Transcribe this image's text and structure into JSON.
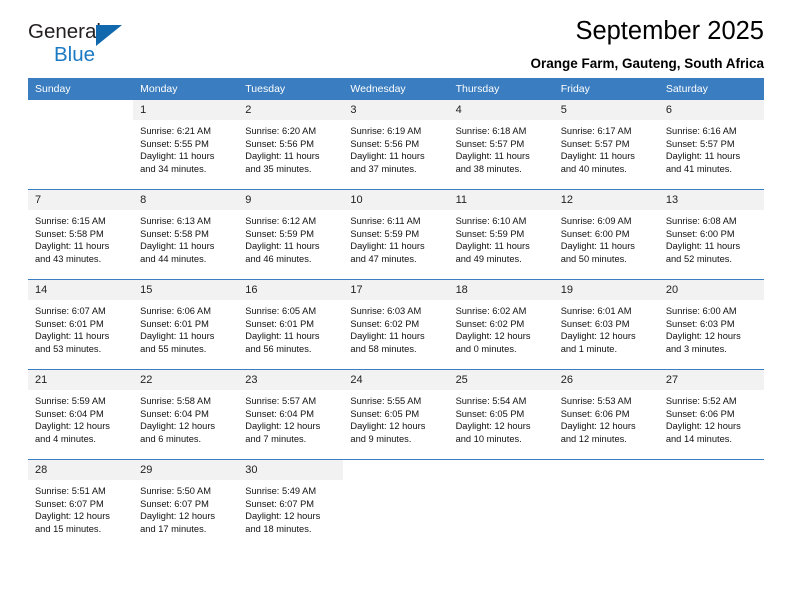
{
  "brand": {
    "name_part1": "General",
    "name_part2": "Blue",
    "logo_icon": "triangle-flag-icon",
    "accent_color": "#1268ad"
  },
  "header": {
    "title": "September 2025",
    "subtitle": "Orange Farm, Gauteng, South Africa"
  },
  "theme": {
    "header_blue": "#3a7dc0",
    "daynum_gray": "#f2f2f2"
  },
  "weekday_headers": [
    "Sunday",
    "Monday",
    "Tuesday",
    "Wednesday",
    "Thursday",
    "Friday",
    "Saturday"
  ],
  "weeks": [
    [
      {
        "day": "",
        "sunrise": "",
        "sunset": "",
        "daylight1": "",
        "daylight2": ""
      },
      {
        "day": "1",
        "sunrise": "Sunrise: 6:21 AM",
        "sunset": "Sunset: 5:55 PM",
        "daylight1": "Daylight: 11 hours",
        "daylight2": "and 34 minutes."
      },
      {
        "day": "2",
        "sunrise": "Sunrise: 6:20 AM",
        "sunset": "Sunset: 5:56 PM",
        "daylight1": "Daylight: 11 hours",
        "daylight2": "and 35 minutes."
      },
      {
        "day": "3",
        "sunrise": "Sunrise: 6:19 AM",
        "sunset": "Sunset: 5:56 PM",
        "daylight1": "Daylight: 11 hours",
        "daylight2": "and 37 minutes."
      },
      {
        "day": "4",
        "sunrise": "Sunrise: 6:18 AM",
        "sunset": "Sunset: 5:57 PM",
        "daylight1": "Daylight: 11 hours",
        "daylight2": "and 38 minutes."
      },
      {
        "day": "5",
        "sunrise": "Sunrise: 6:17 AM",
        "sunset": "Sunset: 5:57 PM",
        "daylight1": "Daylight: 11 hours",
        "daylight2": "and 40 minutes."
      },
      {
        "day": "6",
        "sunrise": "Sunrise: 6:16 AM",
        "sunset": "Sunset: 5:57 PM",
        "daylight1": "Daylight: 11 hours",
        "daylight2": "and 41 minutes."
      }
    ],
    [
      {
        "day": "7",
        "sunrise": "Sunrise: 6:15 AM",
        "sunset": "Sunset: 5:58 PM",
        "daylight1": "Daylight: 11 hours",
        "daylight2": "and 43 minutes."
      },
      {
        "day": "8",
        "sunrise": "Sunrise: 6:13 AM",
        "sunset": "Sunset: 5:58 PM",
        "daylight1": "Daylight: 11 hours",
        "daylight2": "and 44 minutes."
      },
      {
        "day": "9",
        "sunrise": "Sunrise: 6:12 AM",
        "sunset": "Sunset: 5:59 PM",
        "daylight1": "Daylight: 11 hours",
        "daylight2": "and 46 minutes."
      },
      {
        "day": "10",
        "sunrise": "Sunrise: 6:11 AM",
        "sunset": "Sunset: 5:59 PM",
        "daylight1": "Daylight: 11 hours",
        "daylight2": "and 47 minutes."
      },
      {
        "day": "11",
        "sunrise": "Sunrise: 6:10 AM",
        "sunset": "Sunset: 5:59 PM",
        "daylight1": "Daylight: 11 hours",
        "daylight2": "and 49 minutes."
      },
      {
        "day": "12",
        "sunrise": "Sunrise: 6:09 AM",
        "sunset": "Sunset: 6:00 PM",
        "daylight1": "Daylight: 11 hours",
        "daylight2": "and 50 minutes."
      },
      {
        "day": "13",
        "sunrise": "Sunrise: 6:08 AM",
        "sunset": "Sunset: 6:00 PM",
        "daylight1": "Daylight: 11 hours",
        "daylight2": "and 52 minutes."
      }
    ],
    [
      {
        "day": "14",
        "sunrise": "Sunrise: 6:07 AM",
        "sunset": "Sunset: 6:01 PM",
        "daylight1": "Daylight: 11 hours",
        "daylight2": "and 53 minutes."
      },
      {
        "day": "15",
        "sunrise": "Sunrise: 6:06 AM",
        "sunset": "Sunset: 6:01 PM",
        "daylight1": "Daylight: 11 hours",
        "daylight2": "and 55 minutes."
      },
      {
        "day": "16",
        "sunrise": "Sunrise: 6:05 AM",
        "sunset": "Sunset: 6:01 PM",
        "daylight1": "Daylight: 11 hours",
        "daylight2": "and 56 minutes."
      },
      {
        "day": "17",
        "sunrise": "Sunrise: 6:03 AM",
        "sunset": "Sunset: 6:02 PM",
        "daylight1": "Daylight: 11 hours",
        "daylight2": "and 58 minutes."
      },
      {
        "day": "18",
        "sunrise": "Sunrise: 6:02 AM",
        "sunset": "Sunset: 6:02 PM",
        "daylight1": "Daylight: 12 hours",
        "daylight2": "and 0 minutes."
      },
      {
        "day": "19",
        "sunrise": "Sunrise: 6:01 AM",
        "sunset": "Sunset: 6:03 PM",
        "daylight1": "Daylight: 12 hours",
        "daylight2": "and 1 minute."
      },
      {
        "day": "20",
        "sunrise": "Sunrise: 6:00 AM",
        "sunset": "Sunset: 6:03 PM",
        "daylight1": "Daylight: 12 hours",
        "daylight2": "and 3 minutes."
      }
    ],
    [
      {
        "day": "21",
        "sunrise": "Sunrise: 5:59 AM",
        "sunset": "Sunset: 6:04 PM",
        "daylight1": "Daylight: 12 hours",
        "daylight2": "and 4 minutes."
      },
      {
        "day": "22",
        "sunrise": "Sunrise: 5:58 AM",
        "sunset": "Sunset: 6:04 PM",
        "daylight1": "Daylight: 12 hours",
        "daylight2": "and 6 minutes."
      },
      {
        "day": "23",
        "sunrise": "Sunrise: 5:57 AM",
        "sunset": "Sunset: 6:04 PM",
        "daylight1": "Daylight: 12 hours",
        "daylight2": "and 7 minutes."
      },
      {
        "day": "24",
        "sunrise": "Sunrise: 5:55 AM",
        "sunset": "Sunset: 6:05 PM",
        "daylight1": "Daylight: 12 hours",
        "daylight2": "and 9 minutes."
      },
      {
        "day": "25",
        "sunrise": "Sunrise: 5:54 AM",
        "sunset": "Sunset: 6:05 PM",
        "daylight1": "Daylight: 12 hours",
        "daylight2": "and 10 minutes."
      },
      {
        "day": "26",
        "sunrise": "Sunrise: 5:53 AM",
        "sunset": "Sunset: 6:06 PM",
        "daylight1": "Daylight: 12 hours",
        "daylight2": "and 12 minutes."
      },
      {
        "day": "27",
        "sunrise": "Sunrise: 5:52 AM",
        "sunset": "Sunset: 6:06 PM",
        "daylight1": "Daylight: 12 hours",
        "daylight2": "and 14 minutes."
      }
    ],
    [
      {
        "day": "28",
        "sunrise": "Sunrise: 5:51 AM",
        "sunset": "Sunset: 6:07 PM",
        "daylight1": "Daylight: 12 hours",
        "daylight2": "and 15 minutes."
      },
      {
        "day": "29",
        "sunrise": "Sunrise: 5:50 AM",
        "sunset": "Sunset: 6:07 PM",
        "daylight1": "Daylight: 12 hours",
        "daylight2": "and 17 minutes."
      },
      {
        "day": "30",
        "sunrise": "Sunrise: 5:49 AM",
        "sunset": "Sunset: 6:07 PM",
        "daylight1": "Daylight: 12 hours",
        "daylight2": "and 18 minutes."
      },
      {
        "day": "",
        "sunrise": "",
        "sunset": "",
        "daylight1": "",
        "daylight2": ""
      },
      {
        "day": "",
        "sunrise": "",
        "sunset": "",
        "daylight1": "",
        "daylight2": ""
      },
      {
        "day": "",
        "sunrise": "",
        "sunset": "",
        "daylight1": "",
        "daylight2": ""
      },
      {
        "day": "",
        "sunrise": "",
        "sunset": "",
        "daylight1": "",
        "daylight2": ""
      }
    ]
  ]
}
